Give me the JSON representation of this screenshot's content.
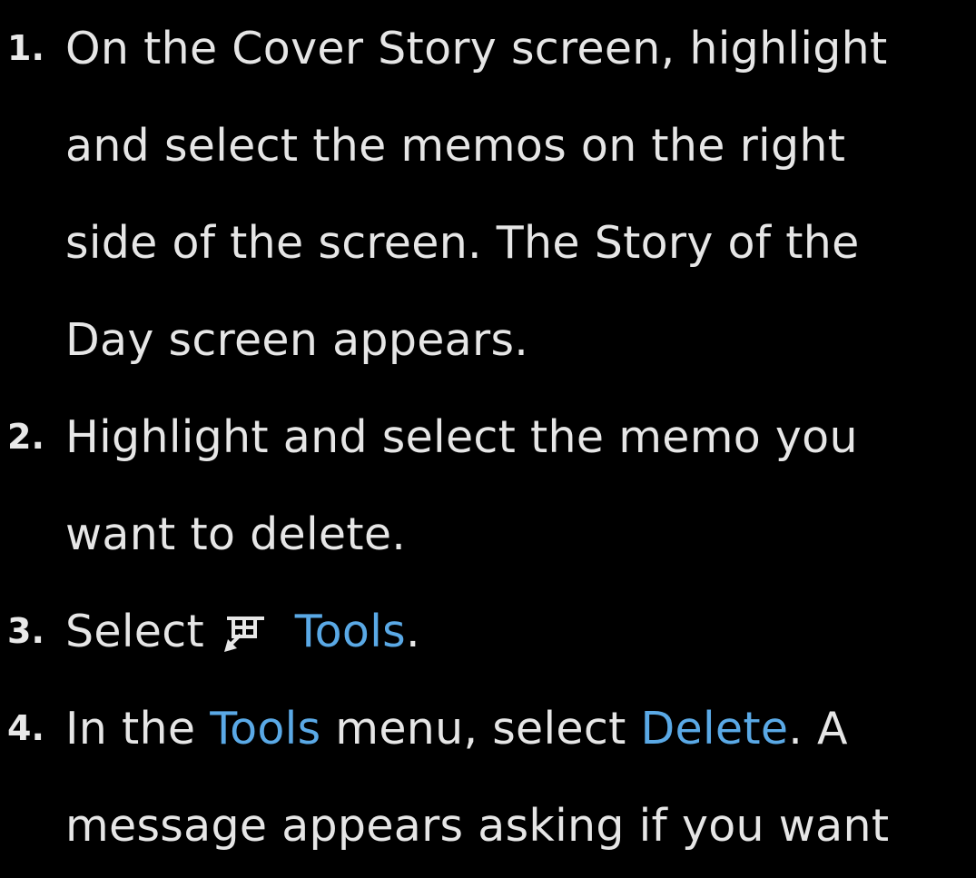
{
  "steps": [
    {
      "number": "1.",
      "lines": [
        "On the Cover Story screen, highlight",
        "and select the memos on the right",
        "side of the screen. The Story of the",
        "Day screen appears."
      ]
    },
    {
      "number": "2.",
      "lines": [
        "Highlight and select the memo you",
        "want to delete."
      ]
    },
    {
      "number": "3.",
      "prefix": "Select",
      "icon": "tools-icon",
      "link": "Tools",
      "suffix": "."
    },
    {
      "number": "4.",
      "line1": {
        "a": "In the ",
        "tools": "Tools",
        "b": " menu, select ",
        "delete": "Delete",
        "c": ". A"
      },
      "line2": "message appears asking if you want"
    }
  ],
  "colors": {
    "background": "#000000",
    "text": "#e6e6e6",
    "highlight": "#5aa9e6"
  }
}
